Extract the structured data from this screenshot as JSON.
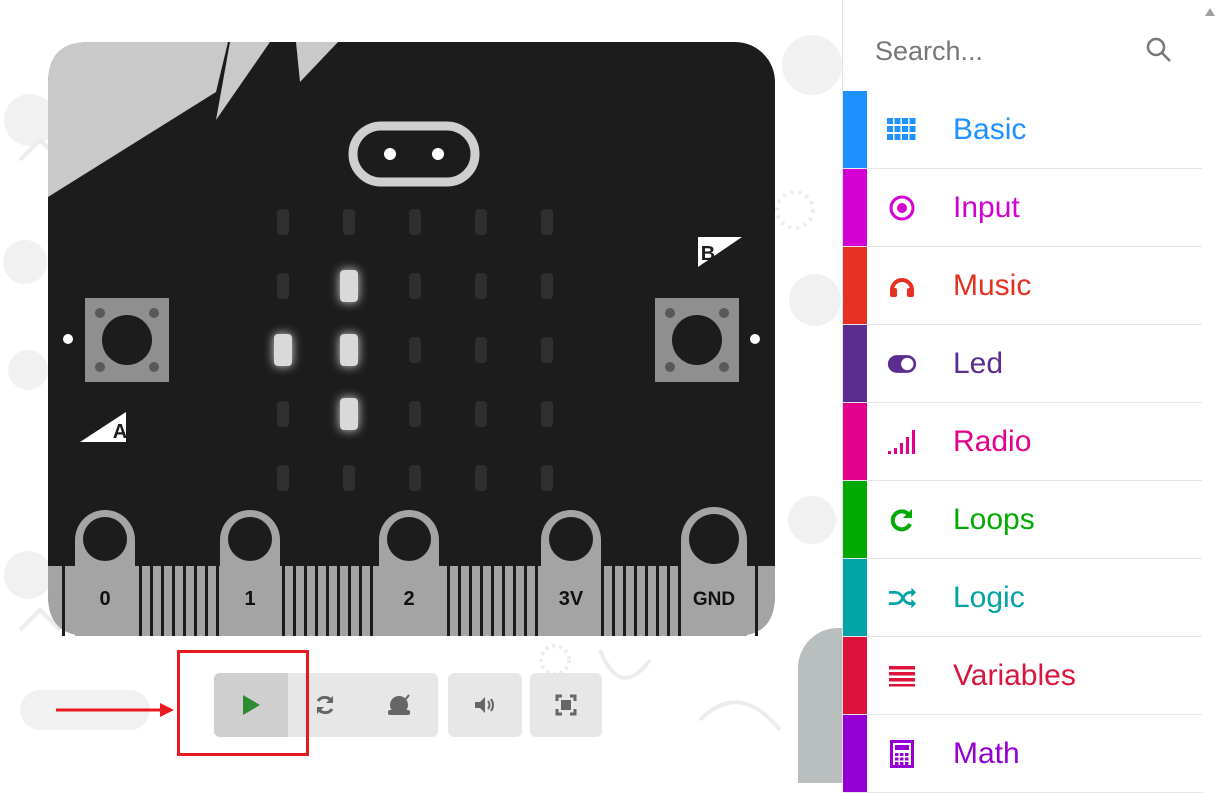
{
  "simulator": {
    "button_a_label": "A",
    "button_b_label": "B",
    "pins": [
      {
        "label": "0"
      },
      {
        "label": "1"
      },
      {
        "label": "2"
      },
      {
        "label": "3V"
      },
      {
        "label": "GND"
      }
    ],
    "led_matrix": [
      [
        0,
        0,
        0,
        0,
        0
      ],
      [
        0,
        1,
        0,
        0,
        0
      ],
      [
        1,
        1,
        0,
        0,
        0
      ],
      [
        0,
        1,
        0,
        0,
        0
      ],
      [
        0,
        0,
        0,
        0,
        0
      ]
    ],
    "colors": {
      "board": "#1c1c1c",
      "led_on": "#d9d9d9",
      "led_off": "#2f2f2f",
      "pin": "#a4a4a4"
    }
  },
  "toolbar": {
    "buttons": [
      {
        "name": "play-button",
        "icon": "play-icon"
      },
      {
        "name": "restart-button",
        "icon": "refresh-icon"
      },
      {
        "name": "slow-mo-button",
        "icon": "snail-icon"
      },
      {
        "name": "mute-button",
        "icon": "volume-icon"
      },
      {
        "name": "fullscreen-button",
        "icon": "fullscreen-icon"
      }
    ],
    "highlight_color": "#e8191e"
  },
  "toolbox": {
    "search": {
      "placeholder": "Search..."
    },
    "categories": [
      {
        "label": "Basic",
        "color": "#1e90ff",
        "icon": "grid-icon"
      },
      {
        "label": "Input",
        "color": "#d400d4",
        "icon": "target-icon"
      },
      {
        "label": "Music",
        "color": "#e63022",
        "icon": "headphones-icon"
      },
      {
        "label": "Led",
        "color": "#5c2d91",
        "icon": "toggle-icon"
      },
      {
        "label": "Radio",
        "color": "#e3008c",
        "icon": "signal-icon"
      },
      {
        "label": "Loops",
        "color": "#00aa00",
        "icon": "loop-icon"
      },
      {
        "label": "Logic",
        "color": "#00a4a6",
        "icon": "shuffle-icon"
      },
      {
        "label": "Variables",
        "color": "#dc143c",
        "icon": "lines-icon"
      },
      {
        "label": "Math",
        "color": "#9400d3",
        "icon": "calculator-icon"
      }
    ]
  }
}
